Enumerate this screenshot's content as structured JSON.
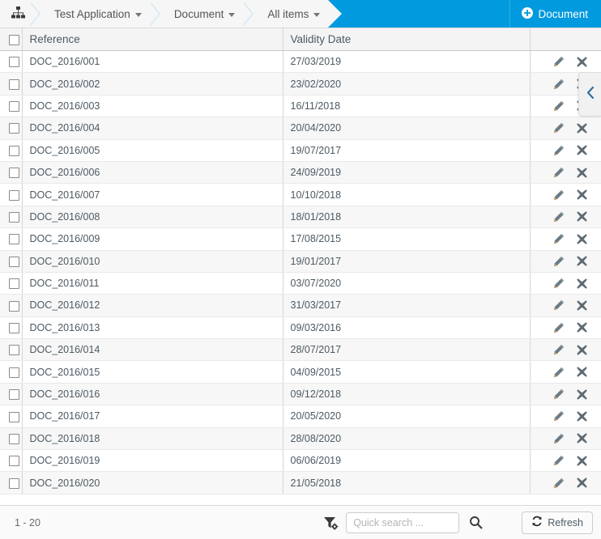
{
  "topbar": {
    "home_icon": "sitemap-icon",
    "breadcrumb": [
      {
        "label": "Test Application",
        "caret": "chevron-down-icon"
      },
      {
        "label": "Document",
        "caret": "chevron-down-icon"
      },
      {
        "label": "All items",
        "caret": "chevron-down-icon"
      }
    ],
    "action": {
      "icon": "plus-circle-icon",
      "label": "Document"
    },
    "background_color": "#019ade"
  },
  "panel_handle": {
    "icon": "chevron-left-icon"
  },
  "table": {
    "select_all": {
      "name": "select-all-checkbox",
      "checked": false
    },
    "columns": [
      {
        "key": "check",
        "label": ""
      },
      {
        "key": "reference",
        "label": "Reference"
      },
      {
        "key": "validity_date",
        "label": "Validity Date"
      },
      {
        "key": "actions",
        "label": ""
      }
    ],
    "row_actions": [
      {
        "name": "edit-row-button",
        "icon": "pencil-icon"
      },
      {
        "name": "delete-row-button",
        "icon": "close-x-icon"
      }
    ],
    "rows": [
      {
        "reference": "DOC_2016/001",
        "validity_date": "27/03/2019"
      },
      {
        "reference": "DOC_2016/002",
        "validity_date": "23/02/2020"
      },
      {
        "reference": "DOC_2016/003",
        "validity_date": "16/11/2018"
      },
      {
        "reference": "DOC_2016/004",
        "validity_date": "20/04/2020"
      },
      {
        "reference": "DOC_2016/005",
        "validity_date": "19/07/2017"
      },
      {
        "reference": "DOC_2016/006",
        "validity_date": "24/09/2019"
      },
      {
        "reference": "DOC_2016/007",
        "validity_date": "10/10/2018"
      },
      {
        "reference": "DOC_2016/008",
        "validity_date": "18/01/2018"
      },
      {
        "reference": "DOC_2016/009",
        "validity_date": "17/08/2015"
      },
      {
        "reference": "DOC_2016/010",
        "validity_date": "19/01/2017"
      },
      {
        "reference": "DOC_2016/011",
        "validity_date": "03/07/2020"
      },
      {
        "reference": "DOC_2016/012",
        "validity_date": "31/03/2017"
      },
      {
        "reference": "DOC_2016/013",
        "validity_date": "09/03/2016"
      },
      {
        "reference": "DOC_2016/014",
        "validity_date": "28/07/2017"
      },
      {
        "reference": "DOC_2016/015",
        "validity_date": "04/09/2015"
      },
      {
        "reference": "DOC_2016/016",
        "validity_date": "09/12/2018"
      },
      {
        "reference": "DOC_2016/017",
        "validity_date": "20/05/2020"
      },
      {
        "reference": "DOC_2016/018",
        "validity_date": "28/08/2020"
      },
      {
        "reference": "DOC_2016/019",
        "validity_date": "06/06/2019"
      },
      {
        "reference": "DOC_2016/020",
        "validity_date": "21/05/2018"
      }
    ]
  },
  "footer": {
    "range_label": "1 - 20",
    "filter_icon": "filter-settings-icon",
    "search": {
      "value": "",
      "placeholder": "Quick search ...",
      "submit_icon": "search-icon"
    },
    "refresh": {
      "icon": "refresh-icon",
      "label": "Refresh"
    }
  }
}
